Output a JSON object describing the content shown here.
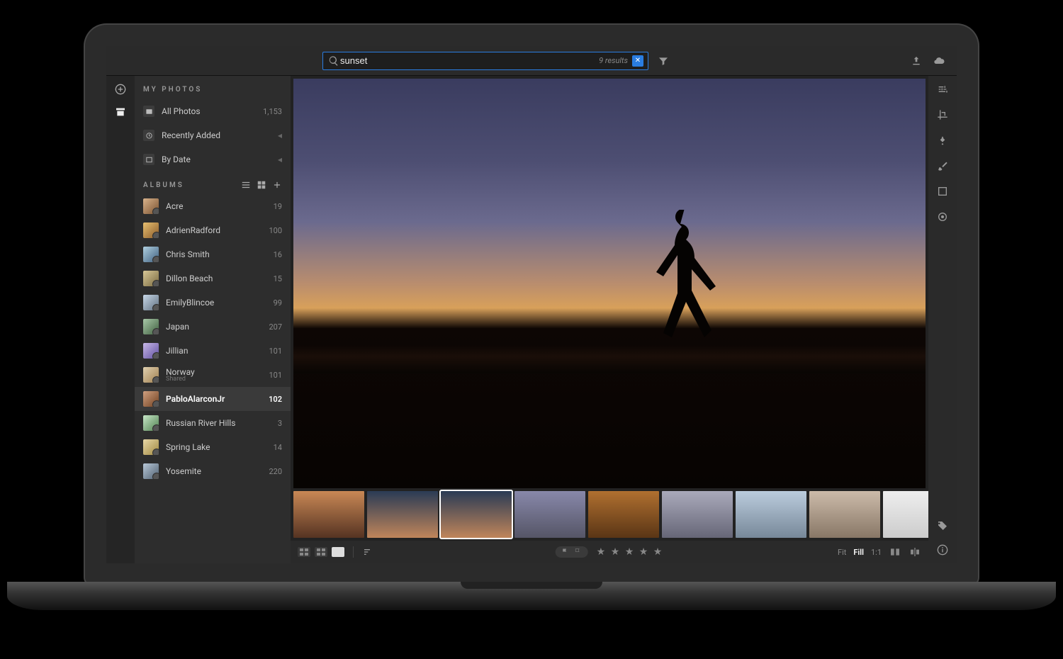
{
  "search": {
    "query": "sunset",
    "results_label": "9 results"
  },
  "sidebar": {
    "my_photos_title": "MY PHOTOS",
    "all_photos_label": "All Photos",
    "all_photos_count": "1,153",
    "recently_added_label": "Recently Added",
    "by_date_label": "By Date",
    "albums_title": "ALBUMS",
    "albums": [
      {
        "name": "Acre",
        "count": "19"
      },
      {
        "name": "AdrienRadford",
        "count": "100"
      },
      {
        "name": "Chris Smith",
        "count": "16"
      },
      {
        "name": "Dillon Beach",
        "count": "15"
      },
      {
        "name": "EmilyBlincoe",
        "count": "99"
      },
      {
        "name": "Japan",
        "count": "207"
      },
      {
        "name": "Jillian",
        "count": "101"
      },
      {
        "name": "Norway",
        "sub": "Shared",
        "count": "101"
      },
      {
        "name": "PabloAlarconJr",
        "count": "102",
        "selected": true
      },
      {
        "name": "Russian River Hills",
        "count": "3"
      },
      {
        "name": "Spring Lake",
        "count": "14"
      },
      {
        "name": "Yosemite",
        "count": "220"
      }
    ]
  },
  "bottombar": {
    "rating_stars": "★ ★ ★ ★ ★",
    "zoom_fit": "Fit",
    "zoom_fill": "Fill",
    "zoom_11": "1:1"
  }
}
